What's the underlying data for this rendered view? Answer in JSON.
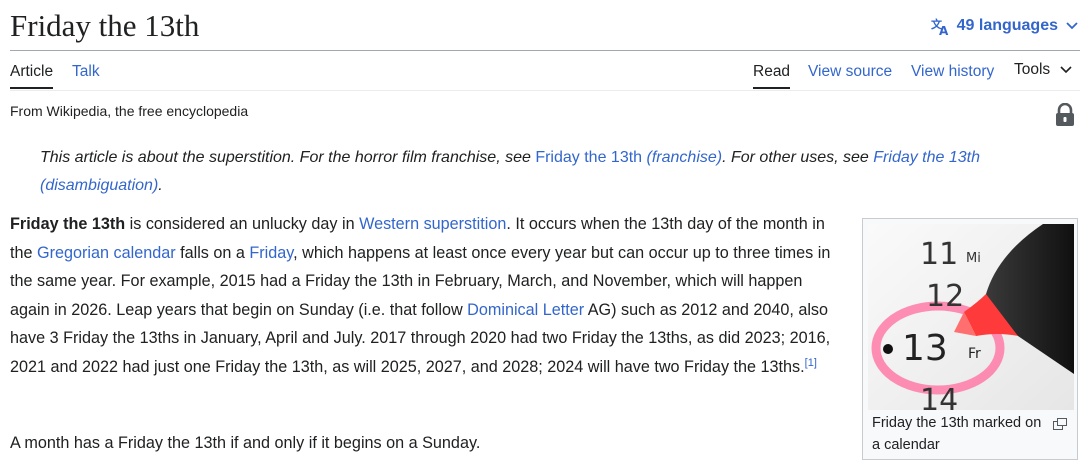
{
  "header": {
    "title": "Friday the 13th",
    "languages_label": "49 languages"
  },
  "tabs": {
    "article": "Article",
    "talk": "Talk",
    "read": "Read",
    "view_source": "View source",
    "view_history": "View history",
    "tools": "Tools"
  },
  "subtitle": "From Wikipedia, the free encyclopedia",
  "hatnote": {
    "text1": "This article is about the superstition. For the horror film franchise, see ",
    "link1_plain": "Friday the 13th",
    "link1_italic": "(franchise)",
    "text2": ". For other uses, see ",
    "link2": "Friday the 13th (disambiguation)",
    "text3": "."
  },
  "para1": {
    "bold": "Friday the 13th",
    "t1": " is considered an unlucky day in ",
    "link_western": "Western superstition",
    "t2": ". It occurs when the 13th day of the month in the ",
    "link_gregorian": "Gregorian calendar",
    "t3": " falls on a ",
    "link_friday": "Friday",
    "t4": ", which happens at least once every year but can occur up to three times in the same year. For example, 2015 had a Friday the 13th in February, March, and November, which will happen again in 2026. Leap years that begin on Sunday (i.e. that follow ",
    "link_dominical": "Dominical Letter",
    "t5": " AG) such as 2012 and 2040, also have 3 Friday the 13ths in January, April and July. 2017 through 2020 had two Friday the 13ths, as did 2023; 2016, 2021 and 2022 had just one Friday the 13th, as will 2025, 2027, and 2028; 2024 will have two Friday the 13ths.",
    "ref": "[1]"
  },
  "para2": "A month has a Friday the 13th if and only if it begins on a Sunday.",
  "thumb": {
    "caption": "Friday the 13th marked on a calendar",
    "calendar_numbers": [
      "11",
      "12",
      "13",
      "14"
    ],
    "calendar_days": [
      "Mi",
      "Fr"
    ]
  },
  "icons": {
    "language": "translate-icon",
    "chevron": "chevron-down-icon",
    "lock": "lock-icon",
    "enlarge": "enlarge-icon"
  },
  "colors": {
    "link": "#3366cc",
    "text": "#202122",
    "border": "#a2a9b1",
    "highlight": "#ff6fa0"
  }
}
